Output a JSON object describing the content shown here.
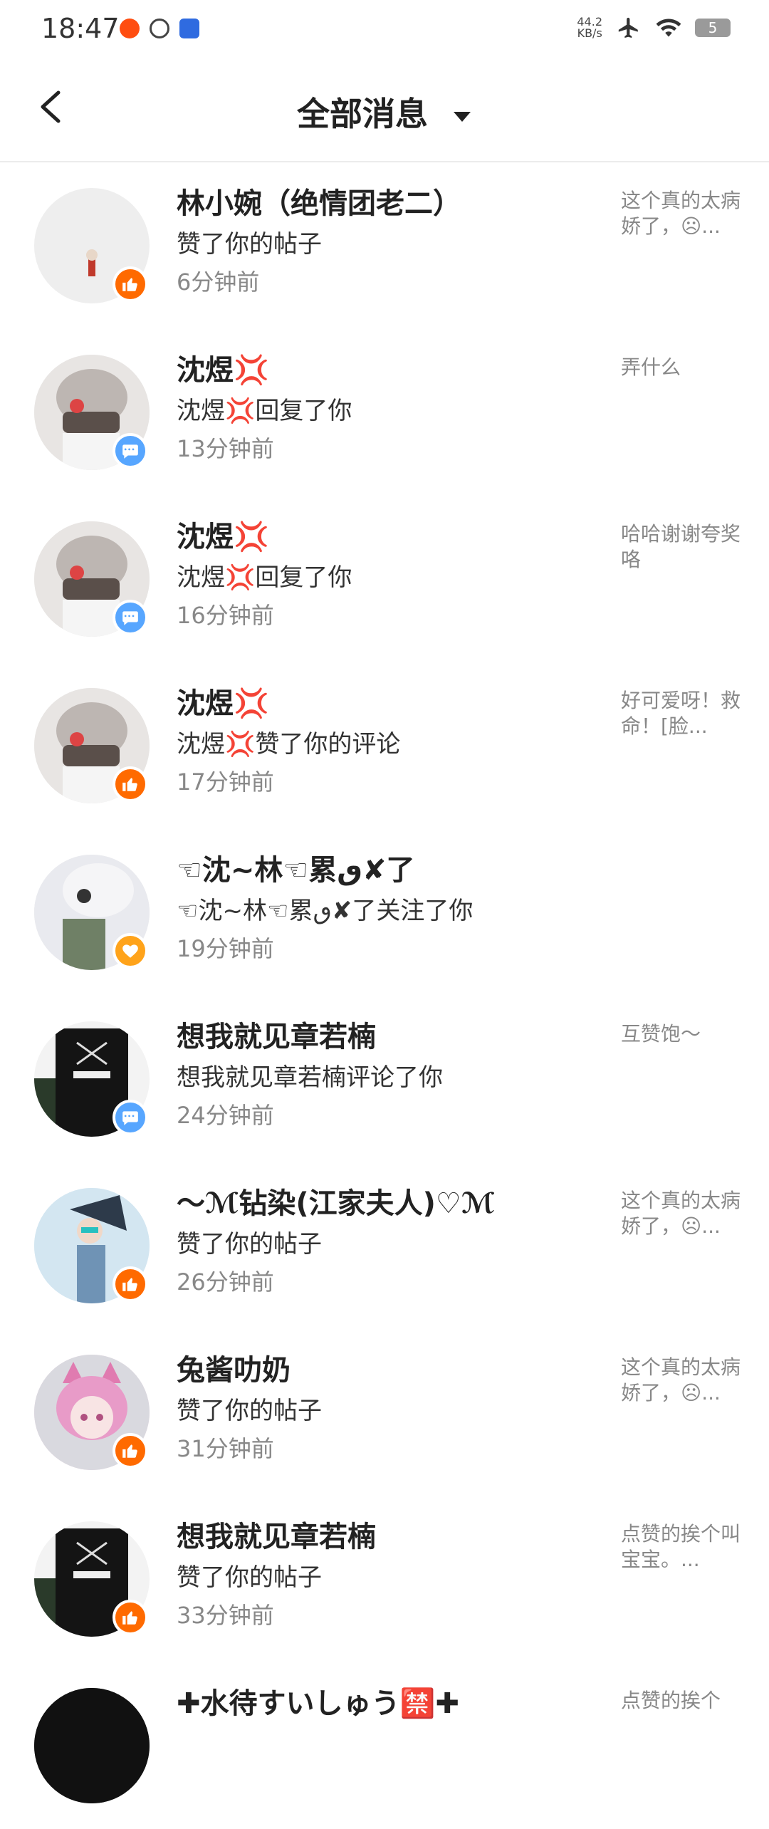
{
  "status": {
    "time": "18:47",
    "net_speed_top": "44.2",
    "net_speed_bottom": "KB/s",
    "battery": "5"
  },
  "header": {
    "title": "全部消息"
  },
  "messages": [
    {
      "name": "林小婉（绝情团老二）",
      "action": "赞了你的帖子",
      "time": "6分钟前",
      "preview": "这个真的太病娇了，☹...",
      "badge": "like"
    },
    {
      "name": "沈煜💢",
      "action": "沈煜💢回复了你",
      "time": "13分钟前",
      "preview": "弄什么",
      "badge": "reply"
    },
    {
      "name": "沈煜💢",
      "action": "沈煜💢回复了你",
      "time": "16分钟前",
      "preview": "哈哈谢谢夸奖咯",
      "badge": "reply"
    },
    {
      "name": "沈煜💢",
      "action": "沈煜💢赞了你的评论",
      "time": "17分钟前",
      "preview": "好可爱呀！救命！[脸...",
      "badge": "like"
    },
    {
      "name": "☜沈~林☜累ٯ✘了",
      "action": "☜沈~林☜累ٯ✘了关注了你",
      "time": "19分钟前",
      "preview": "",
      "badge": "follow"
    },
    {
      "name": "想我就见章若楠",
      "action": "想我就见章若楠评论了你",
      "time": "24分钟前",
      "preview": "互赞饱～",
      "badge": "reply"
    },
    {
      "name": "～ℳ钻染(江家夫人)♡ℳ",
      "action": "赞了你的帖子",
      "time": "26分钟前",
      "preview": "这个真的太病娇了，☹...",
      "badge": "like"
    },
    {
      "name": "兔酱叻奶",
      "action": "赞了你的帖子",
      "time": "31分钟前",
      "preview": "这个真的太病娇了，☹...",
      "badge": "like"
    },
    {
      "name": "想我就见章若楠",
      "action": "赞了你的帖子",
      "time": "33分钟前",
      "preview": " 点赞的挨个叫宝宝。...",
      "badge": "like"
    },
    {
      "name": "✚水待すいしゅう🈲✚",
      "action": "",
      "time": "",
      "preview": "点赞的挨个",
      "badge": "like"
    }
  ]
}
